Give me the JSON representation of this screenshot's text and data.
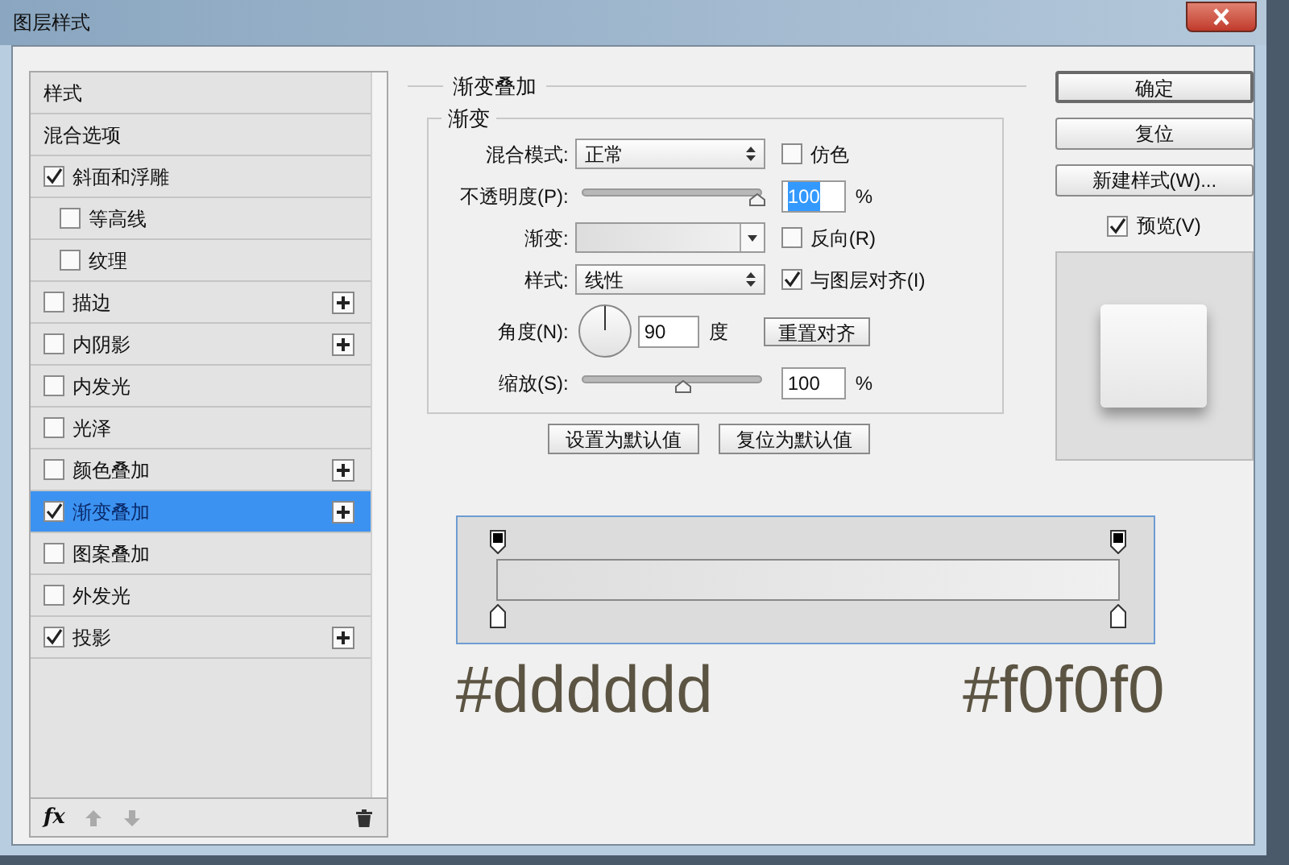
{
  "window": {
    "title": "图层样式"
  },
  "sidebar": {
    "items": [
      {
        "label": "样式",
        "kind": "header",
        "selected": false
      },
      {
        "label": "混合选项",
        "kind": "header",
        "selected": false
      },
      {
        "label": "斜面和浮雕",
        "kind": "effect",
        "checked": true,
        "selected": false,
        "addable": false,
        "children": [
          {
            "label": "等高线",
            "kind": "effect",
            "checked": false,
            "selected": false,
            "addable": false
          },
          {
            "label": "纹理",
            "kind": "effect",
            "checked": false,
            "selected": false,
            "addable": false
          }
        ]
      },
      {
        "label": "描边",
        "kind": "effect",
        "checked": false,
        "selected": false,
        "addable": true
      },
      {
        "label": "内阴影",
        "kind": "effect",
        "checked": false,
        "selected": false,
        "addable": true
      },
      {
        "label": "内发光",
        "kind": "effect",
        "checked": false,
        "selected": false,
        "addable": false
      },
      {
        "label": "光泽",
        "kind": "effect",
        "checked": false,
        "selected": false,
        "addable": false
      },
      {
        "label": "颜色叠加",
        "kind": "effect",
        "checked": false,
        "selected": false,
        "addable": true
      },
      {
        "label": "渐变叠加",
        "kind": "effect",
        "checked": true,
        "selected": true,
        "addable": true
      },
      {
        "label": "图案叠加",
        "kind": "effect",
        "checked": false,
        "selected": false,
        "addable": false
      },
      {
        "label": "外发光",
        "kind": "effect",
        "checked": false,
        "selected": false,
        "addable": false
      },
      {
        "label": "投影",
        "kind": "effect",
        "checked": true,
        "selected": false,
        "addable": true
      }
    ],
    "footer": {
      "fx_label": "fx"
    }
  },
  "panel": {
    "title": "渐变叠加",
    "group_title": "渐变",
    "rows": [
      {
        "kind": "select",
        "label": "混合模式:",
        "value": "正常",
        "checkbox": {
          "label": "仿色",
          "checked": false
        }
      },
      {
        "kind": "slider",
        "label": "不透明度(P):",
        "level": 1.0,
        "value": "100",
        "value_selected": true,
        "unit": "%"
      },
      {
        "kind": "gradient",
        "label": "渐变:",
        "checkbox": {
          "label": "反向(R)",
          "checked": false
        }
      },
      {
        "kind": "select",
        "label": "样式:",
        "value": "线性",
        "checkbox": {
          "label": "与图层对齐(I)",
          "checked": true
        }
      },
      {
        "kind": "angle",
        "label": "角度(N):",
        "value": "90",
        "unit": "度",
        "button": "重置对齐"
      },
      {
        "kind": "slider",
        "label": "缩放(S):",
        "level": 0.57,
        "value": "100",
        "value_selected": false,
        "unit": "%"
      }
    ],
    "buttons": [
      "设置为默认值",
      "复位为默认值"
    ]
  },
  "gradient_editor": {
    "annotations": [
      "#dddddd",
      "#f0f0f0"
    ]
  },
  "actions": {
    "buttons": [
      "确定",
      "复位",
      "新建样式(W)..."
    ],
    "preview": {
      "label": "预览(V)",
      "checked": true
    }
  }
}
